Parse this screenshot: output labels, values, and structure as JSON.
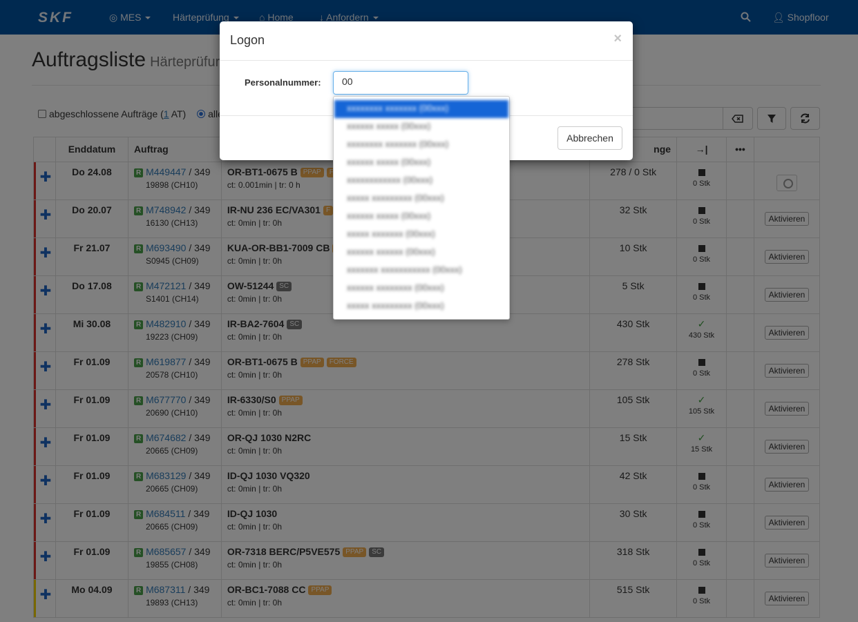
{
  "nav": {
    "brand": "SKF",
    "mes": "MES",
    "haerte": "Härteprüfung",
    "home": "Home",
    "anfordern": "Anfordern",
    "user": "Shopfloor"
  },
  "page": {
    "title": "Auftragsliste",
    "subtitle": "Härteprüfur"
  },
  "filters": {
    "closed_prefix": "abgeschlossene Aufträge (",
    "closed_count": "1",
    "closed_suffix": " AT)",
    "all_label": "alle"
  },
  "table": {
    "headers": {
      "enddatum": "Enddatum",
      "auftrag": "Auftrag",
      "menge": "nge",
      "signin": "→|",
      "more": "•••"
    },
    "rows": [
      {
        "date": "Do 24.08",
        "order": "M449447",
        "op": " / 349",
        "sub": "19898 (CH10)",
        "article": "OR-BT1-0675 B",
        "tags": [
          "PPAP",
          "F"
        ],
        "ct": "ct: 0.001min | tr: 0 h",
        "qty": "278 / 0 Stk",
        "status": "0 Stk",
        "done": false,
        "action": "",
        "bar": "#d9302c"
      },
      {
        "date": "Do 20.07",
        "order": "M748942",
        "op": " / 349",
        "sub": "16130 (CH13)",
        "article": "IR-NU 236 EC/VA301",
        "tags": [
          "F"
        ],
        "ct": "ct: 0min | tr: 0h",
        "qty": "32 Stk",
        "status": "0 Stk",
        "done": false,
        "action": "Aktivieren",
        "bar": "#d9302c"
      },
      {
        "date": "Fr 21.07",
        "order": "M693490",
        "op": " / 349",
        "sub": "S0945 (CH09)",
        "article": "KUA-OR-BB1-7009 CB",
        "tags": [
          "P"
        ],
        "ct": "ct: 0min | tr: 0h",
        "qty": "10 Stk",
        "status": "0 Stk",
        "done": false,
        "action": "Aktivieren",
        "bar": "#d9302c"
      },
      {
        "date": "Do 17.08",
        "order": "M472121",
        "op": " / 349",
        "sub": "S1401 (CH14)",
        "article": "OW-51244",
        "tags": [
          "SC"
        ],
        "ct": "ct: 0min | tr: 0h",
        "qty": "5 Stk",
        "status": "0 Stk",
        "done": false,
        "action": "Aktivieren",
        "bar": "#d9302c"
      },
      {
        "date": "Mi 30.08",
        "order": "M482910",
        "op": " / 349",
        "sub": "19223 (CH09)",
        "article": "IR-BA2-7604",
        "tags": [
          "SC"
        ],
        "ct": "ct: 0min | tr: 0h",
        "qty": "430 Stk",
        "status": "430 Stk",
        "done": true,
        "action": "Aktivieren",
        "bar": "#d9302c"
      },
      {
        "date": "Fr 01.09",
        "order": "M619877",
        "op": " / 349",
        "sub": "20578 (CH10)",
        "article": "OR-BT1-0675 B",
        "tags": [
          "PPAP",
          "FORCE"
        ],
        "ct": "ct: 0min | tr: 0h",
        "qty": "278 Stk",
        "status": "0 Stk",
        "done": false,
        "action": "Aktivieren",
        "bar": "#d9302c"
      },
      {
        "date": "Fr 01.09",
        "order": "M677770",
        "op": " / 349",
        "sub": "20690 (CH10)",
        "article": "IR-6330/S0",
        "tags": [
          "PPAP"
        ],
        "ct": "ct: 0min | tr: 0h",
        "qty": "105 Stk",
        "status": "105 Stk",
        "done": true,
        "action": "Aktivieren",
        "bar": "#d9302c"
      },
      {
        "date": "Fr 01.09",
        "order": "M674682",
        "op": " / 349",
        "sub": "20665 (CH09)",
        "article": "OR-QJ 1030 N2RC",
        "tags": [],
        "ct": "ct: 0min | tr: 0h",
        "qty": "15 Stk",
        "status": "15 Stk",
        "done": true,
        "action": "Aktivieren",
        "bar": "#d9302c"
      },
      {
        "date": "Fr 01.09",
        "order": "M683129",
        "op": " / 349",
        "sub": "20665 (CH09)",
        "article": "ID-QJ 1030 VQ320",
        "tags": [],
        "ct": "ct: 0min | tr: 0h",
        "qty": "42 Stk",
        "status": "0 Stk",
        "done": false,
        "action": "Aktivieren",
        "bar": "#d9302c"
      },
      {
        "date": "Fr 01.09",
        "order": "M684511",
        "op": " / 349",
        "sub": "20665 (CH09)",
        "article": "ID-QJ 1030",
        "tags": [],
        "ct": "ct: 0min | tr: 0h",
        "qty": "30 Stk",
        "status": "0 Stk",
        "done": false,
        "action": "Aktivieren",
        "bar": "#d9302c"
      },
      {
        "date": "Fr 01.09",
        "order": "M685657",
        "op": " / 349",
        "sub": "19855 (CH08)",
        "article": "OR-7318 BERC/P5VE575",
        "tags": [
          "PPAP",
          "SC"
        ],
        "ct": "ct: 0min | tr: 0h",
        "qty": "318 Stk",
        "status": "0 Stk",
        "done": false,
        "action": "Aktivieren",
        "bar": "#d9302c"
      },
      {
        "date": "Mo 04.09",
        "order": "M687311",
        "op": " / 349",
        "sub": "19893 (CH13)",
        "article": "OR-BC1-7088 CC",
        "tags": [
          "PPAP"
        ],
        "ct": "ct: 0min | tr: 0h",
        "qty": "515 Stk",
        "status": "0 Stk",
        "done": false,
        "action": "Aktivieren",
        "bar": "#f0d000"
      }
    ]
  },
  "modal": {
    "title": "Logon",
    "close": "×",
    "label": "Personalnummer:",
    "input_value": "00",
    "cancel": "Abbrechen",
    "options": [
      "xxxxxxxx xxxxxxx (00xxx)",
      "xxxxxx xxxxx (00xxx)",
      "xxxxxxxx xxxxxxx (00xxx)",
      "xxxxxx xxxxx (00xxx)",
      "xxxxxxxxxxxx (00xxx)",
      "xxxxx xxxxxxxxx (00xxx)",
      "xxxxxx xxxxx (00xxx)",
      "xxxxx xxxxxxx (00xxx)",
      "xxxxxx xxxxxx (00xxx)",
      "xxxxxxx xxxxxxxxxxx (00xxx)",
      "xxxxxx xxxxxxxx (00xxx)",
      "xxxxx xxxxxxxxx (00xxx)"
    ]
  }
}
